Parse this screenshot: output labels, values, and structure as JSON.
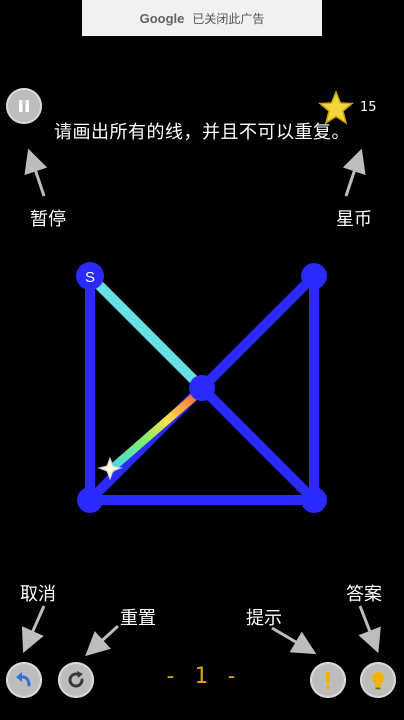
{
  "ad": {
    "brand": "Google",
    "text": "已关闭此广告"
  },
  "instruction": "请画出所有的线，并且不可以重复。",
  "stars": {
    "count": "15"
  },
  "callouts": {
    "pause": "暂停",
    "stars": "星币",
    "undo": "取消",
    "reset": "重置",
    "hint": "提示",
    "answer": "答案"
  },
  "start_marker": "S",
  "level": "- 1 -",
  "colors": {
    "background": "#000000",
    "line": "#2b2bff",
    "node": "#2b2bff",
    "drawn_segment": "#66e0e0",
    "hint_button": "#f0b400",
    "answer_button": "#f0b400"
  },
  "icons": {
    "pause": "pause-icon",
    "star": "star-icon",
    "undo": "undo-icon",
    "reset": "reset-icon",
    "hint": "exclamation-icon",
    "answer": "lightbulb-icon"
  }
}
